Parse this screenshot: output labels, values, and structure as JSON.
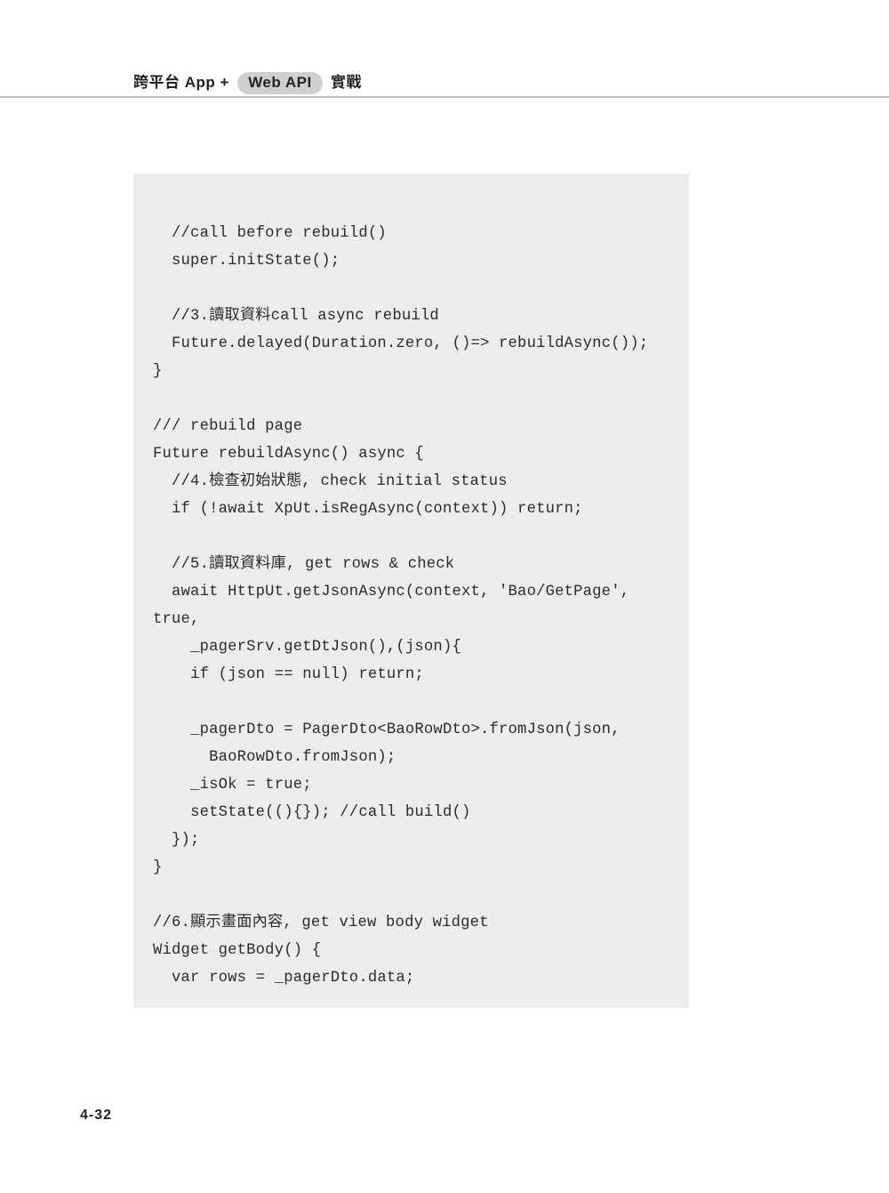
{
  "header": {
    "prefix": "跨平台",
    "app_label": "App",
    "plus": "+",
    "pill": "Web API",
    "suffix": "實戰"
  },
  "code": "  //call before rebuild()\n  super.initState();\n\n  //3.讀取資料call async rebuild\n  Future.delayed(Duration.zero, ()=> rebuildAsync());\n}\n\n/// rebuild page\nFuture rebuildAsync() async {\n  //4.檢查初始狀態, check initial status\n  if (!await XpUt.isRegAsync(context)) return;\n\n  //5.讀取資料庫, get rows & check\n  await HttpUt.getJsonAsync(context, 'Bao/GetPage', true,\n    _pagerSrv.getDtJson(),(json){\n    if (json == null) return;\n\n    _pagerDto = PagerDto<BaoRowDto>.fromJson(json,\n      BaoRowDto.fromJson);\n    _isOk = true;\n    setState((){}); //call build()\n  });\n}\n\n//6.顯示畫面內容, get view body widget\nWidget getBody() {\n  var rows = _pagerDto.data;",
  "page_number": "4-32"
}
